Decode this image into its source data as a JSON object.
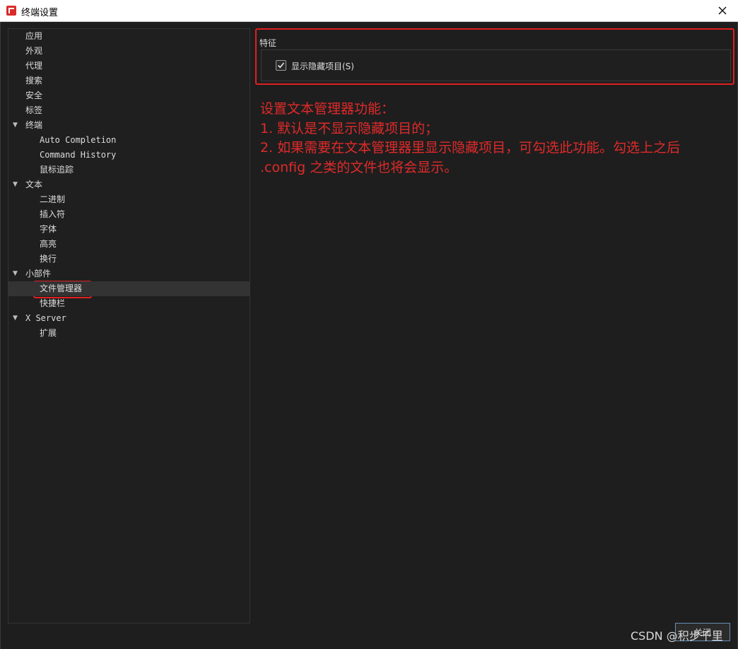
{
  "window": {
    "title": "终端设置"
  },
  "tree": {
    "items": [
      {
        "label": "应用",
        "level": 0,
        "expandable": false,
        "mono": false
      },
      {
        "label": "外观",
        "level": 0,
        "expandable": false,
        "mono": false
      },
      {
        "label": "代理",
        "level": 0,
        "expandable": false,
        "mono": false
      },
      {
        "label": "搜索",
        "level": 0,
        "expandable": false,
        "mono": false
      },
      {
        "label": "安全",
        "level": 0,
        "expandable": false,
        "mono": false
      },
      {
        "label": "标签",
        "level": 0,
        "expandable": false,
        "mono": false
      },
      {
        "label": "终端",
        "level": 0,
        "expandable": true,
        "mono": false
      },
      {
        "label": "Auto Completion",
        "level": 1,
        "expandable": false,
        "mono": true
      },
      {
        "label": "Command History",
        "level": 1,
        "expandable": false,
        "mono": true
      },
      {
        "label": "鼠标追踪",
        "level": 1,
        "expandable": false,
        "mono": false
      },
      {
        "label": "文本",
        "level": 0,
        "expandable": true,
        "mono": false
      },
      {
        "label": "二进制",
        "level": 1,
        "expandable": false,
        "mono": false
      },
      {
        "label": "插入符",
        "level": 1,
        "expandable": false,
        "mono": false
      },
      {
        "label": "字体",
        "level": 1,
        "expandable": false,
        "mono": false
      },
      {
        "label": "高亮",
        "level": 1,
        "expandable": false,
        "mono": false
      },
      {
        "label": "换行",
        "level": 1,
        "expandable": false,
        "mono": false
      },
      {
        "label": "小部件",
        "level": 0,
        "expandable": true,
        "mono": false
      },
      {
        "label": "文件管理器",
        "level": 1,
        "expandable": false,
        "mono": false,
        "selected": true
      },
      {
        "label": "快捷栏",
        "level": 1,
        "expandable": false,
        "mono": false
      },
      {
        "label": "X Server",
        "level": 0,
        "expandable": true,
        "mono": true
      },
      {
        "label": "扩展",
        "level": 1,
        "expandable": false,
        "mono": false
      }
    ]
  },
  "panel": {
    "section_title": "特征",
    "checkbox": {
      "label": "显示隐藏项目(S)",
      "checked": true
    }
  },
  "annotation": {
    "lines": [
      "设置文本管理器功能：",
      "1. 默认是不显示隐藏项目的；",
      "2. 如果需要在文本管理器里显示隐藏项目，可勾选此功能。勾选上之后",
      ".config 之类的文件也将会显示。"
    ]
  },
  "footer": {
    "button_label": "关闭",
    "watermark": "CSDN @积步千里"
  },
  "colors": {
    "background": "#1e1e1e",
    "text": "#dcdcdc",
    "annotation_red": "#e02a2a",
    "selected_row": "#333333"
  }
}
